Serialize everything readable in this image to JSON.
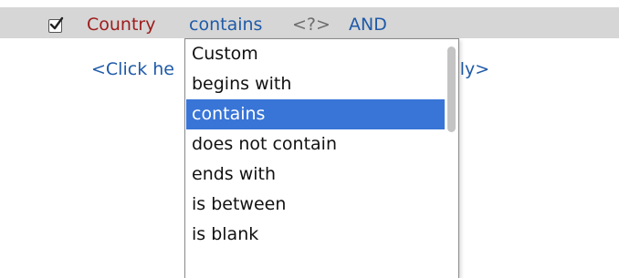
{
  "filter": {
    "checked": true,
    "field_name": "Country",
    "operator": "contains",
    "operand_placeholder": "<?>",
    "join": "AND"
  },
  "hint": {
    "text_left": "<Click he",
    "text_right": "apply>"
  },
  "dropdown": {
    "options": [
      "Custom",
      "begins with",
      "contains",
      "does not contain",
      "ends with",
      "is between",
      "is blank"
    ],
    "selected": "contains"
  },
  "colors": {
    "row_background": "#d6d6d6",
    "field_name": "#9e1b1b",
    "link": "#1f5aa8",
    "selection": "#3875d7"
  }
}
